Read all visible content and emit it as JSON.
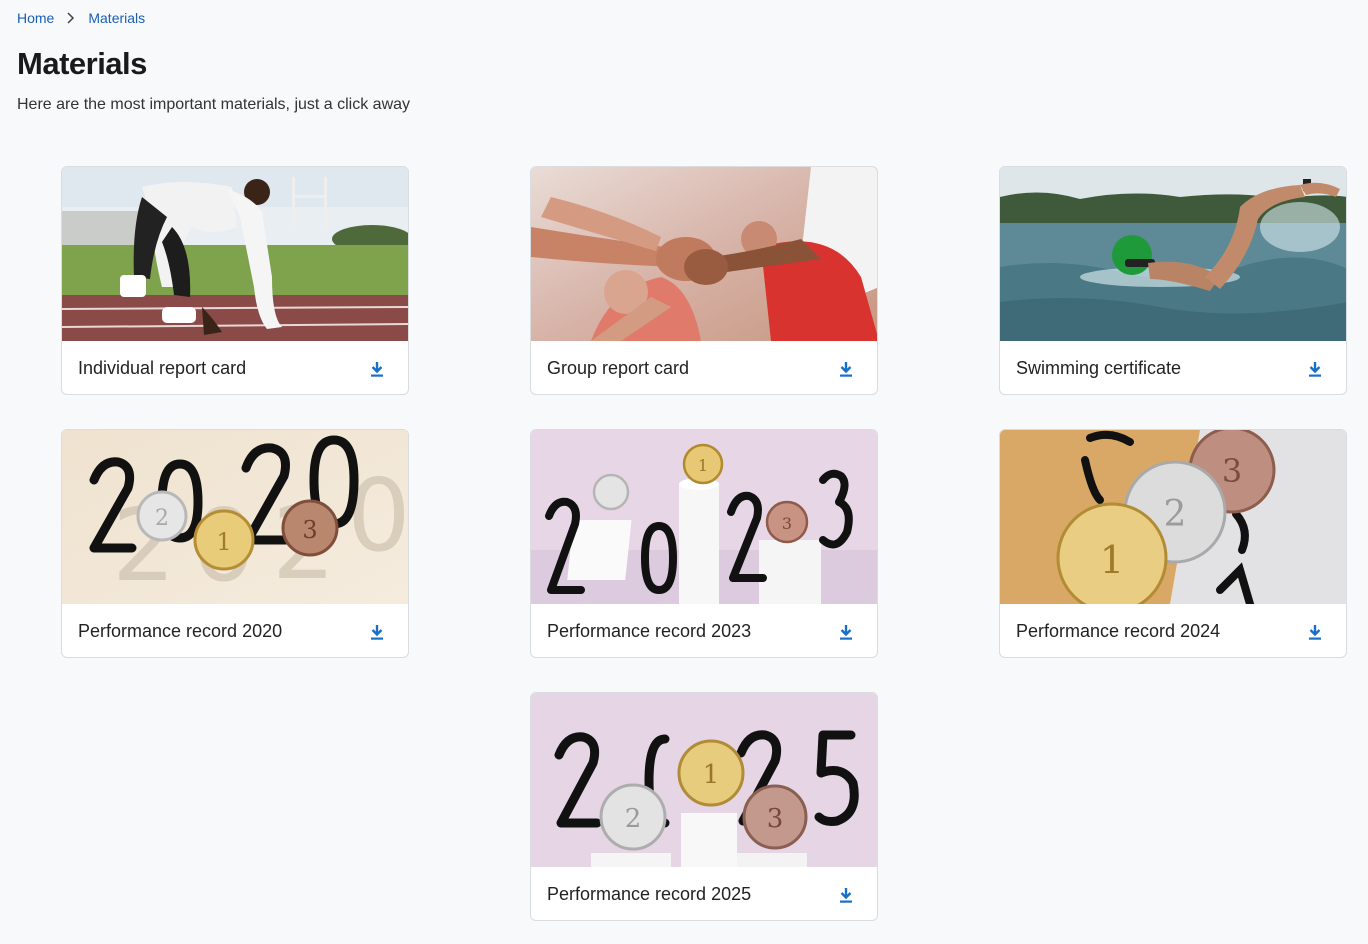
{
  "breadcrumb": {
    "home": "Home",
    "current": "Materials"
  },
  "page": {
    "title": "Materials",
    "subtitle": "Here are the most important materials, just a click away"
  },
  "accent_color": "#1a6fc9",
  "cards": [
    {
      "label": "Individual report card"
    },
    {
      "label": "Group report card"
    },
    {
      "label": "Swimming certificate"
    },
    {
      "label": "Performance record 2020"
    },
    {
      "label": "Performance record 2023"
    },
    {
      "label": "Performance record 2024"
    },
    {
      "label": "Performance record 2025"
    }
  ],
  "icons": {
    "breadcrumb_separator": "chevron-right-icon",
    "download": "download-icon"
  }
}
